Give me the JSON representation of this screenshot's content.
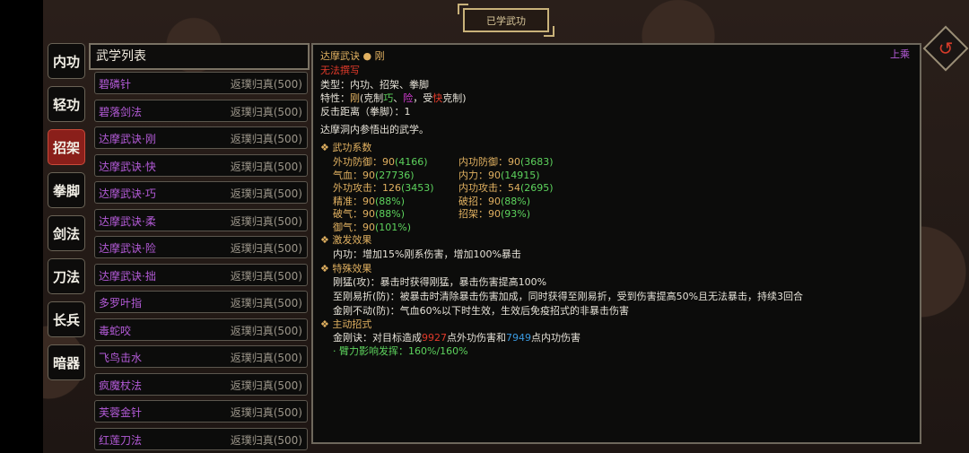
{
  "header": {
    "title": "已学武功"
  },
  "categories": [
    "内功",
    "轻功",
    "招架",
    "拳脚",
    "剑法",
    "刀法",
    "长兵",
    "暗器"
  ],
  "active_category_index": 2,
  "list": {
    "title": "武学列表",
    "items": [
      {
        "name": "碧磷针",
        "status": "返璞归真(500)"
      },
      {
        "name": "碧落剑法",
        "status": "返璞归真(500)"
      },
      {
        "name": "达摩武诀·刚",
        "status": "返璞归真(500)"
      },
      {
        "name": "达摩武诀·快",
        "status": "返璞归真(500)"
      },
      {
        "name": "达摩武诀·巧",
        "status": "返璞归真(500)"
      },
      {
        "name": "达摩武诀·柔",
        "status": "返璞归真(500)"
      },
      {
        "name": "达摩武诀·险",
        "status": "返璞归真(500)"
      },
      {
        "name": "达摩武诀·拙",
        "status": "返璞归真(500)"
      },
      {
        "name": "多罗叶指",
        "status": "返璞归真(500)"
      },
      {
        "name": "毒蛇咬",
        "status": "返璞归真(500)"
      },
      {
        "name": "飞鸟击水",
        "status": "返璞归真(500)"
      },
      {
        "name": "疯魔杖法",
        "status": "返璞归真(500)"
      },
      {
        "name": "芙蓉金针",
        "status": "返璞归真(500)"
      },
      {
        "name": "红莲刀法",
        "status": "返璞归真(500)"
      }
    ]
  },
  "detail": {
    "name": "达摩武诀",
    "tag": "刚",
    "warning": "无法撰写",
    "shang": "上乘",
    "type_line": "类型：内功、招架、拳脚",
    "trait_prefix": "特性：",
    "trait_main": "刚",
    "trait_mid1": "(克制",
    "trait_qiao": "巧",
    "trait_sep": "、",
    "trait_xian": "险",
    "trait_mid2": "，受",
    "trait_kuai": "快",
    "trait_end": "克制)",
    "counter_line": "反击距离（拳脚）：1",
    "desc": "达摩洞内参悟出的武学。",
    "coef_title": "武功系数",
    "coefs": [
      {
        "label": "外功防御：90",
        "val": "(4166)"
      },
      {
        "label": "内功防御：90",
        "val": "(3683)"
      },
      {
        "label": "气血：90",
        "val": "(27736)"
      },
      {
        "label": "内力：90",
        "val": "(14915)"
      },
      {
        "label": "外功攻击：126",
        "val": "(3453)"
      },
      {
        "label": "内功攻击：54",
        "val": "(2695)"
      },
      {
        "label": "精准：90",
        "val": "(88%)"
      },
      {
        "label": "破招：90",
        "val": "(88%)"
      },
      {
        "label": "破气：90",
        "val": "(88%)"
      },
      {
        "label": "招架：90",
        "val": "(93%)"
      },
      {
        "label": "御气：90",
        "val": "(101%)"
      }
    ],
    "trigger_title": "激发效果",
    "trigger_text": "内功：增加15%刚系伤害，增加100%暴击",
    "special_title": "特殊效果",
    "special_1": "刚猛(攻)：暴击时获得刚猛，暴击伤害提高100%",
    "special_2": "至刚易折(防)：被暴击时清除暴击伤害加成，同时获得至刚易折，受到伤害提高50%且无法暴击，持续3回合",
    "special_3": "金刚不动(防)：气血60%以下时生效，生效后免疫招式的非暴击伤害",
    "active_title": "主动招式",
    "active_a": "金刚诀：对目标造成",
    "active_dmg1": "9927",
    "active_b": "点外功伤害和",
    "active_dmg2": "7949",
    "active_c": "点内功伤害",
    "active_sub": "· 臂力影响发挥：160%/160%"
  },
  "colors": {
    "accent": "#e0b060",
    "purple": "#b45bd8",
    "active_tab": "#8a1f1a",
    "green": "#5dd35d"
  }
}
